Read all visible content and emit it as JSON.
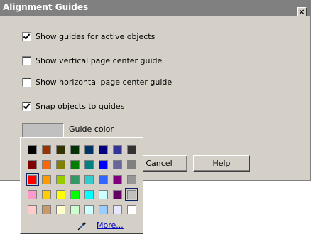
{
  "window": {
    "title": "Alignment Guides",
    "close_label": "×"
  },
  "options": [
    {
      "label": "Show guides for active objects",
      "checked": true
    },
    {
      "label": "Show vertical page center guide",
      "checked": false
    },
    {
      "label": "Show horizontal page center guide",
      "checked": false
    },
    {
      "label": "Snap objects to guides",
      "checked": true
    }
  ],
  "guide_color": {
    "label": "Guide color",
    "current": "#c0c0c0"
  },
  "buttons": {
    "cancel": "Cancel",
    "help": "Help"
  },
  "palette": {
    "rows": [
      [
        "#000000",
        "#993300",
        "#333300",
        "#003300",
        "#003366",
        "#000080",
        "#333399",
        "#333333"
      ],
      [
        "#800000",
        "#ff6600",
        "#808000",
        "#008000",
        "#008080",
        "#0000ff",
        "#666699",
        "#808080"
      ],
      [
        "#ff0000",
        "#ff9900",
        "#99cc00",
        "#339966",
        "#33cccc",
        "#3366ff",
        "#800080",
        "#969696"
      ],
      [
        "#ff99cc",
        "#ffcc00",
        "#ffff00",
        "#00ff00",
        "#00ffff",
        "#ccffff",
        "#660066",
        "#c0c0c0"
      ],
      [
        "#ffcccc",
        "#cc9966",
        "#ffffcc",
        "#ccffcc",
        "#ccffff",
        "#99ccff",
        "#e6e6ff",
        "#ffffff"
      ]
    ],
    "more_label": "More...",
    "dropper_icon": "eyedropper-icon"
  }
}
